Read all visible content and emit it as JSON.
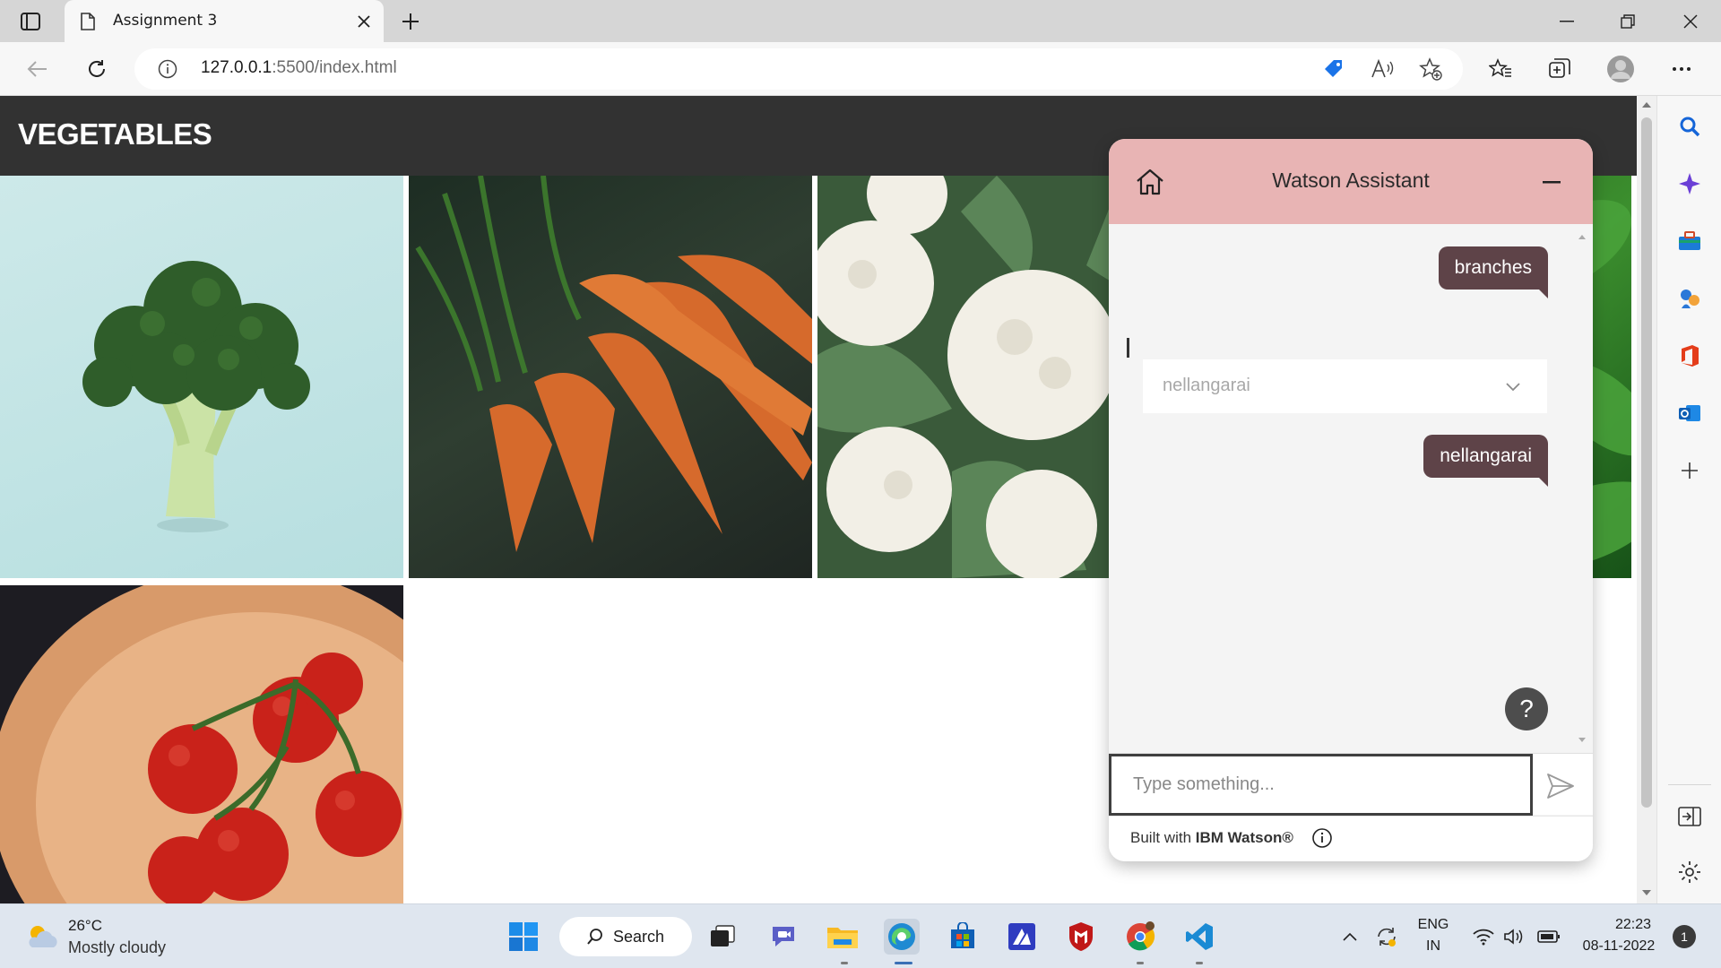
{
  "browser": {
    "tab_title": "Assignment 3",
    "url_host": "127.0.0.1",
    "url_rest": ":5500/index.html"
  },
  "page": {
    "header_title": "VEGETABLES",
    "tiles": [
      "broccoli",
      "carrots",
      "cauliflower",
      "spinach",
      "tomatoes"
    ]
  },
  "assistant": {
    "title": "Watson Assistant",
    "messages": [
      {
        "from": "user",
        "text": "branches"
      },
      {
        "from": "user",
        "text": "nellangarai"
      }
    ],
    "dropdown_value": "nellangarai",
    "input_placeholder": "Type something...",
    "footer_prefix": "Built with ",
    "footer_brand": "IBM Watson®",
    "help_label": "?"
  },
  "taskbar": {
    "temperature": "26°C",
    "condition": "Mostly cloudy",
    "search_label": "Search",
    "lang_top": "ENG",
    "lang_bottom": "IN",
    "time": "22:23",
    "date": "08-11-2022",
    "notification_count": "1"
  },
  "colors": {
    "header_bg": "#323232",
    "assistant_header": "#e8b4b4",
    "bubble": "#5e4348",
    "taskbar": "#dfe6ef"
  }
}
